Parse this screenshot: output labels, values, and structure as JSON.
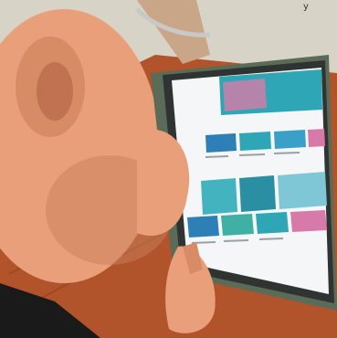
{
  "scene": {
    "description_tag": "",
    "colors": {
      "background": "#ffffff",
      "floor_wood": "#b1542b",
      "floor_wood_light": "#d87a46",
      "skin": "#e9a07a",
      "skin_shadow": "#c97d59",
      "tablet_frame": "#2f3432",
      "tablet_case": "#5a6b57",
      "screen_bg": "#f5f6f7",
      "accent_blue": "#2e7fb5",
      "sea_teal": "#2fa6b6",
      "pink": "#d87aa9",
      "shirt_dark": "#1a1a1a"
    },
    "partial_top_text": "y"
  }
}
